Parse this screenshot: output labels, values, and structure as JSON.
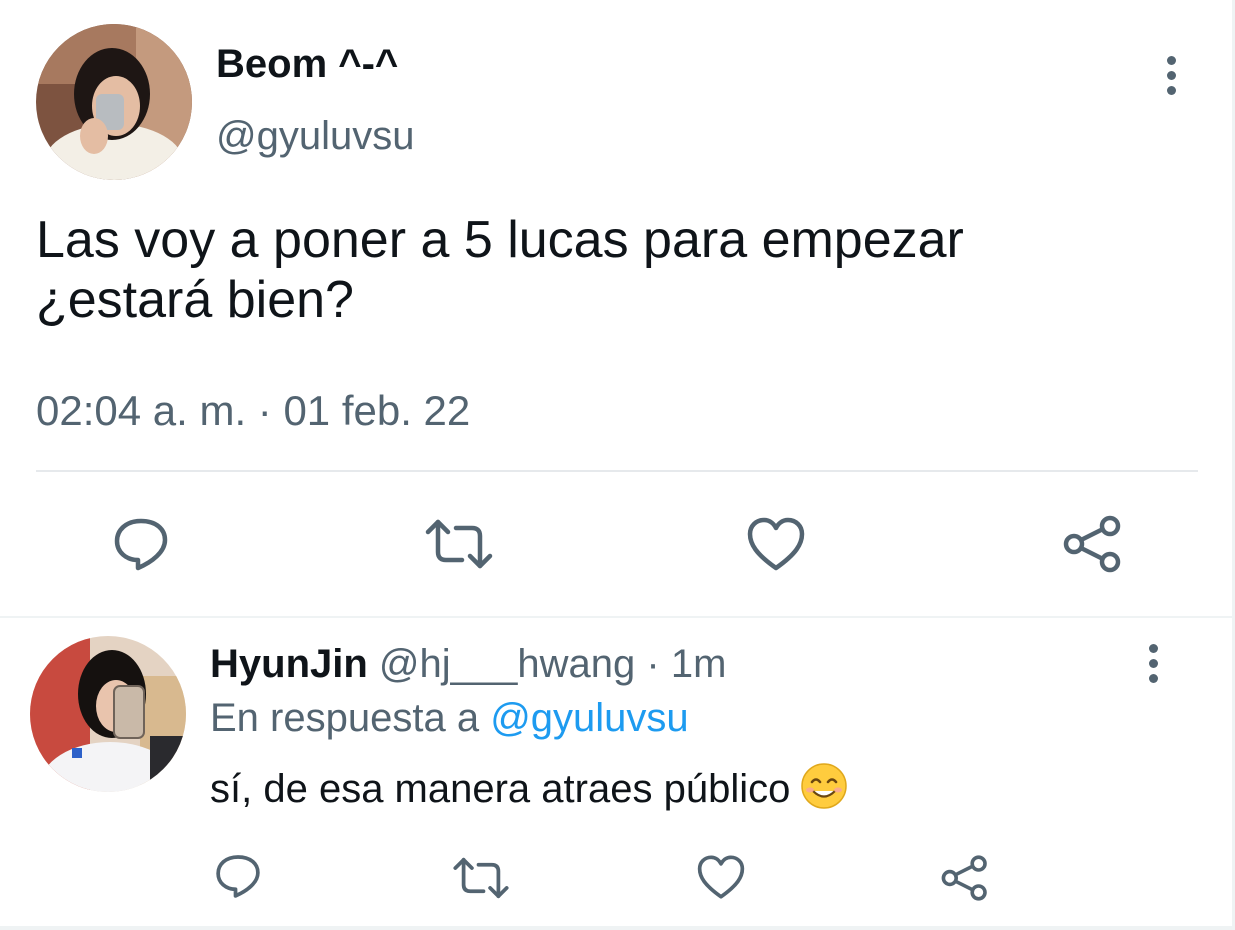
{
  "main_tweet": {
    "display_name": "Beom ^-^",
    "handle": "@gyuluvsu",
    "text_line1": "Las voy a poner a 5 lucas para empezar",
    "text_line2": "¿estará bien?",
    "timestamp": "02:04 a. m. · 01 feb. 22",
    "avatar_icon": "user-avatar-photo"
  },
  "reply_tweet": {
    "display_name": "HyunJin",
    "handle_time": "@hj___hwang · 1m",
    "reply_prefix": "En respuesta a",
    "reply_to": "@gyuluvsu",
    "text": "sí, de esa manera atraes público",
    "emoji_icon": "smiling-face-emoji",
    "avatar_icon": "user-avatar-photo"
  },
  "colors": {
    "text": "#0f1419",
    "muted": "#536471",
    "link": "#1d9bf0",
    "divider": "#e6e9ec"
  },
  "icons": [
    "reply-icon",
    "retweet-icon",
    "like-icon",
    "share-icon",
    "more-options-icon"
  ]
}
